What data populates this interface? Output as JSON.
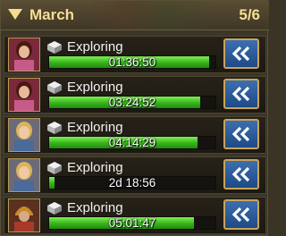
{
  "header": {
    "title": "March",
    "count": "5/6"
  },
  "marches": [
    {
      "status": "Exploring",
      "time": "01:36:50",
      "progress": 0.96,
      "avatar": "hero-portrait-pink",
      "action_icon": "speed-up-double-chevron-icon"
    },
    {
      "status": "Exploring",
      "time": "03:24:52",
      "progress": 0.91,
      "avatar": "hero-portrait-pink",
      "action_icon": "speed-up-double-chevron-icon"
    },
    {
      "status": "Exploring",
      "time": "04:14:29",
      "progress": 0.89,
      "avatar": "hero-portrait-blonde",
      "action_icon": "speed-up-double-chevron-icon"
    },
    {
      "status": "Exploring",
      "time": "2d 18:56",
      "progress": 0.03,
      "avatar": "hero-portrait-blonde",
      "action_icon": "speed-up-double-chevron-icon"
    },
    {
      "status": "Exploring",
      "time": "05:01:47",
      "progress": 0.87,
      "avatar": "hero-portrait-helmet",
      "action_icon": "speed-up-double-chevron-icon"
    }
  ],
  "colors": {
    "header_text": "#f5de93",
    "progress_green": "#35b31b",
    "button_blue": "#2b5c9c",
    "button_border": "#c9a458"
  }
}
